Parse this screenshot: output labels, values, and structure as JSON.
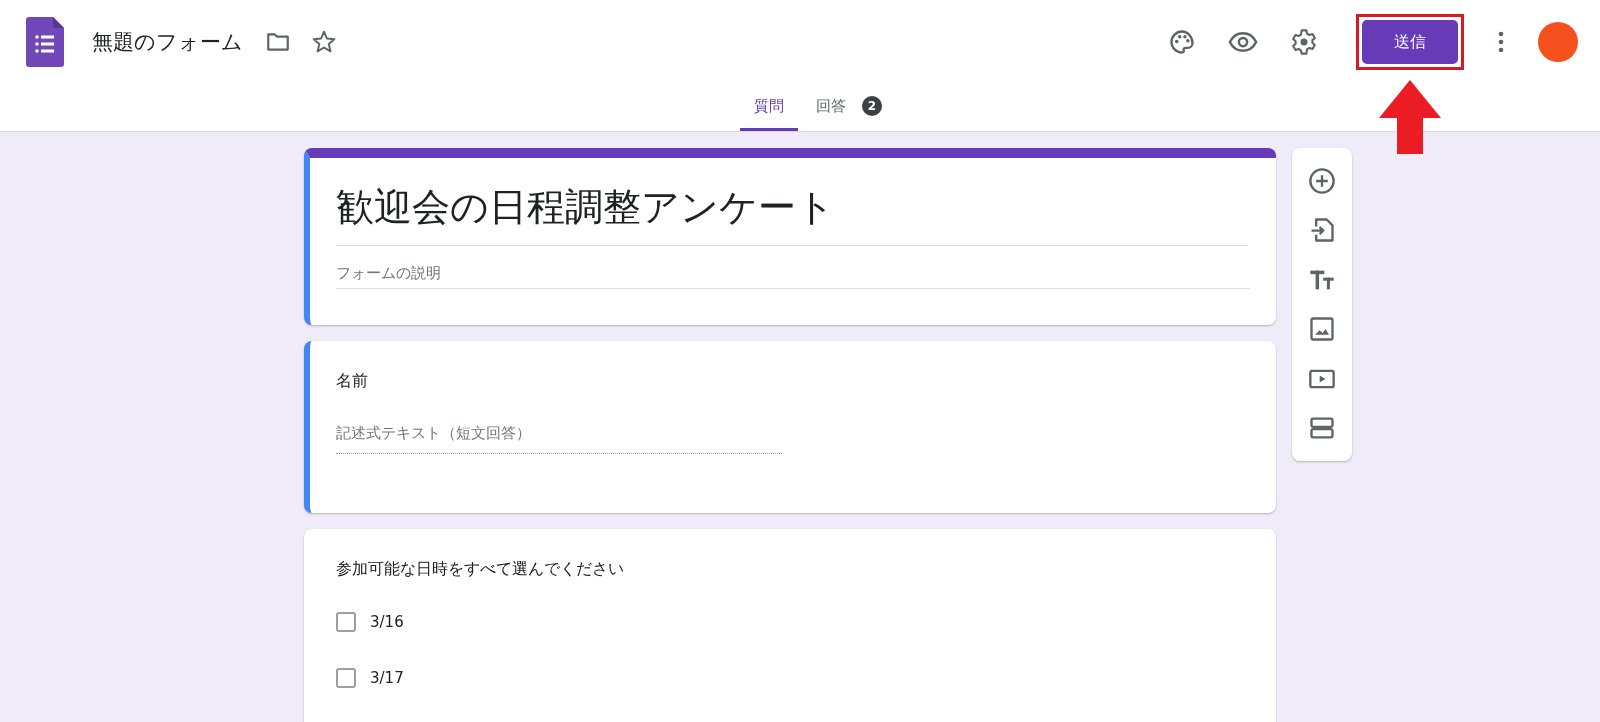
{
  "header": {
    "title": "無題のフォーム",
    "send_button": "送信"
  },
  "tabs": [
    {
      "label": "質問",
      "selected": true
    },
    {
      "label": "回答",
      "selected": false,
      "badge": "2"
    }
  ],
  "form": {
    "title": "歓迎会の日程調整アンケート",
    "description_placeholder": "フォームの説明",
    "active": true
  },
  "questions": [
    {
      "kind": "short",
      "title": "名前",
      "active": true,
      "placeholder": "記述式テキスト（短文回答）"
    },
    {
      "kind": "checkbox",
      "title": "参加可能な日時をすべて選んでください",
      "active": false,
      "options": [
        {
          "label": "3/16",
          "checked": false
        },
        {
          "label": "3/17",
          "checked": false
        }
      ]
    }
  ]
}
